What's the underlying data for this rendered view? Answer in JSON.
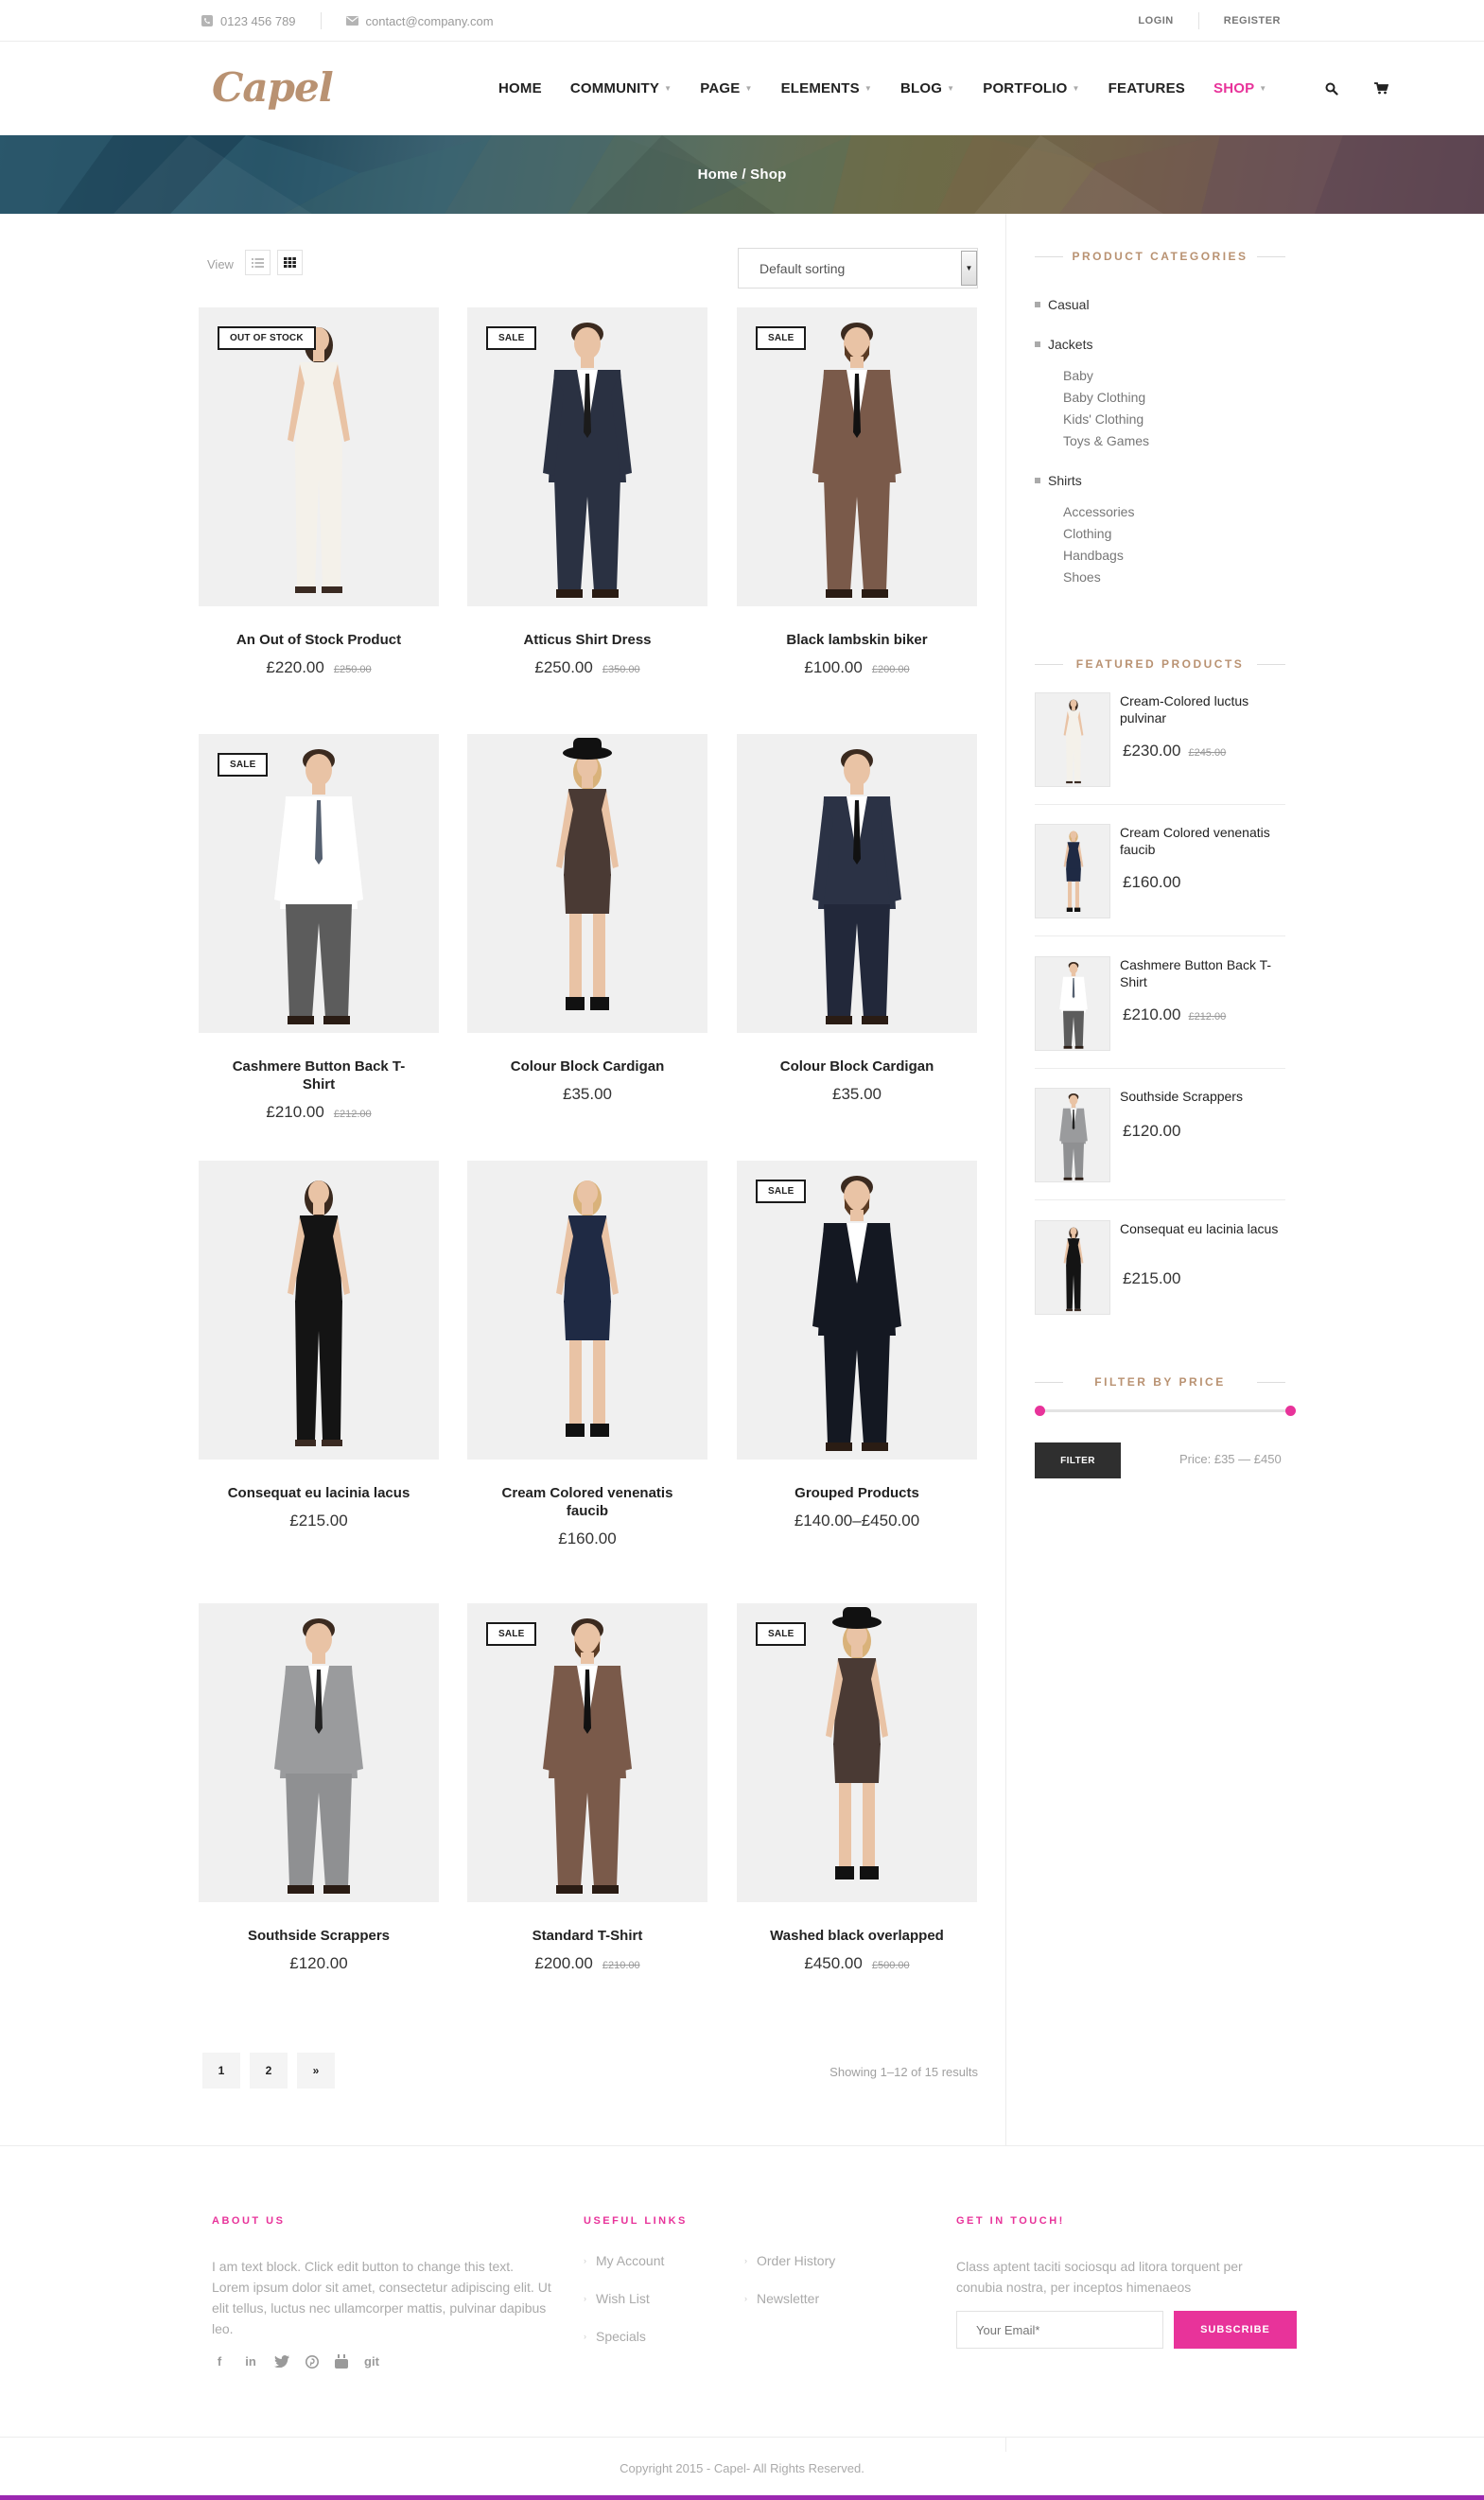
{
  "topbar": {
    "phone": "0123 456 789",
    "email": "contact@company.com",
    "login": "LOGIN",
    "register": "REGISTER"
  },
  "header": {
    "logo": "Capel",
    "nav": [
      {
        "label": "HOME",
        "dropdown": false
      },
      {
        "label": "COMMUNITY",
        "dropdown": true
      },
      {
        "label": "PAGE",
        "dropdown": true
      },
      {
        "label": "ELEMENTS",
        "dropdown": true
      },
      {
        "label": "BLOG",
        "dropdown": true
      },
      {
        "label": "PORTFOLIO",
        "dropdown": true
      },
      {
        "label": "FEATURES",
        "dropdown": false
      },
      {
        "label": "SHOP",
        "dropdown": true,
        "active": true
      }
    ]
  },
  "banner": {
    "breadcrumb": "Home / Shop"
  },
  "toolbar": {
    "view_label": "View",
    "sorting": "Default sorting"
  },
  "products": [
    {
      "name": "An Out of Stock Product",
      "price": "£220.00",
      "old_price": "£250.00",
      "badge": "OUT OF STOCK"
    },
    {
      "name": "Atticus Shirt Dress",
      "price": "£250.00",
      "old_price": "£350.00",
      "badge": "SALE"
    },
    {
      "name": "Black lambskin biker",
      "price": "£100.00",
      "old_price": "£200.00",
      "badge": "SALE"
    },
    {
      "name": "Cashmere Button Back T-Shirt",
      "price": "£210.00",
      "old_price": "£212.00",
      "badge": "SALE"
    },
    {
      "name": "Colour Block Cardigan",
      "price": "£35.00",
      "old_price": "",
      "badge": ""
    },
    {
      "name": "Colour Block Cardigan",
      "price": "£35.00",
      "old_price": "",
      "badge": ""
    },
    {
      "name": "Consequat eu lacinia lacus",
      "price": "£215.00",
      "old_price": "",
      "badge": ""
    },
    {
      "name": "Cream Colored venenatis faucib",
      "price": "£160.00",
      "old_price": "",
      "badge": ""
    },
    {
      "name": "Grouped Products",
      "price": "£140.00–£450.00",
      "old_price": "",
      "badge": "SALE"
    },
    {
      "name": "Southside Scrappers",
      "price": "£120.00",
      "old_price": "",
      "badge": ""
    },
    {
      "name": "Standard T-Shirt",
      "price": "£200.00",
      "old_price": "£210.00",
      "badge": "SALE"
    },
    {
      "name": "Washed black overlapped",
      "price": "£450.00",
      "old_price": "£500.00",
      "badge": "SALE"
    }
  ],
  "pagination": {
    "pages": [
      "1",
      "2",
      "»"
    ],
    "showing": "Showing 1–12 of 15 results"
  },
  "sidebar": {
    "categories_title": "PRODUCT CATEGORIES",
    "categories": [
      {
        "label": "Casual",
        "children": []
      },
      {
        "label": "Jackets",
        "children": [
          "Baby",
          "Baby Clothing",
          "Kids' Clothing",
          "Toys & Games"
        ]
      },
      {
        "label": "Shirts",
        "children": [
          "Accessories",
          "Clothing",
          "Handbags",
          "Shoes"
        ]
      }
    ],
    "featured_title": "FEATURED PRODUCTS",
    "featured": [
      {
        "title": "Cream-Colored luctus pulvinar",
        "price": "£230.00",
        "old_price": "£245.00"
      },
      {
        "title": "Cream Colored venenatis faucib",
        "price": "£160.00",
        "old_price": ""
      },
      {
        "title": "Cashmere Button Back T-Shirt",
        "price": "£210.00",
        "old_price": "£212.00"
      },
      {
        "title": "Southside Scrappers",
        "price": "£120.00",
        "old_price": ""
      },
      {
        "title": "Consequat eu lacinia lacus",
        "price": "£215.00",
        "old_price": ""
      }
    ],
    "filter_title": "FILTER BY PRICE",
    "filter_button": "FILTER",
    "price_range": "Price: £35 — £450"
  },
  "footer": {
    "about_title": "ABOUT US",
    "about_text": "I am text block. Click edit button to change this text. Lorem ipsum dolor sit amet, consectetur adipiscing elit. Ut elit tellus, luctus nec ullamcorper mattis, pulvinar dapibus leo.",
    "links_title": "USEFUL LINKS",
    "links_col1": [
      "My Account",
      "Wish List",
      "Specials"
    ],
    "links_col2": [
      "Order History",
      "Newsletter"
    ],
    "contact_title": "GET IN TOUCH!",
    "contact_text": "Class aptent taciti sociosqu ad litora torquent per conubia nostra, per inceptos himenaeos",
    "email_placeholder": "Your Email*",
    "subscribe": "SUBSCRIBE",
    "copyright": "Copyright 2015 - Capel- All Rights Reserved."
  },
  "colors": {
    "accent": "#e8339a",
    "gold": "#b99272",
    "dark": "#2f2f2f",
    "bottom_bar": "#9b27b0"
  },
  "icons": [
    "phone-icon",
    "mail-icon",
    "search-icon",
    "cart-icon",
    "list-view-icon",
    "grid-view-icon",
    "facebook-icon",
    "linkedin-icon",
    "twitter-icon",
    "pinterest-icon",
    "youtube-icon",
    "git-icon"
  ]
}
